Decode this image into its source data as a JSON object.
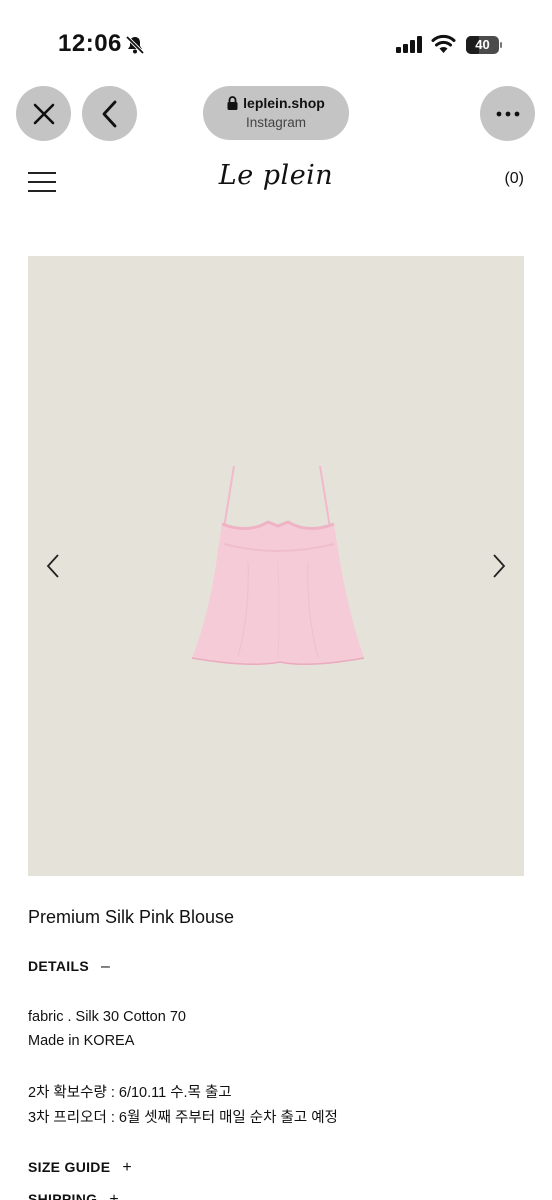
{
  "status_bar": {
    "time": "12:06",
    "battery": "40",
    "battery_level": 0.4,
    "icons": [
      "bell-slash-icon",
      "cellular-signal-icon",
      "wifi-icon",
      "battery-icon"
    ]
  },
  "browser": {
    "domain": "leplein.shop",
    "source": "Instagram",
    "icons": [
      "close-icon",
      "back-chevron-icon",
      "lock-icon",
      "more-icon"
    ]
  },
  "site": {
    "logo": "Le plein",
    "cart": "(0)",
    "icons": [
      "hamburger-menu-icon"
    ]
  },
  "gallery": {
    "background": "#e5e2d9",
    "garment_color": "#f6cbd8",
    "icons": [
      "chevron-left-icon",
      "chevron-right-icon"
    ]
  },
  "product": {
    "title": "Premium Silk Pink Blouse",
    "details_label": "DETAILS",
    "details_toggle": "–",
    "details_lines": [
      "fabric . Silk 30 Cotton 70",
      "Made in KOREA",
      "2차 확보수량 : 6/10.11 수.목 출고",
      "3차 프리오더 : 6월 셋째 주부터 매일 순차 출고 예정"
    ],
    "size_guide_label": "SIZE GUIDE",
    "size_guide_toggle": "+",
    "shipping_label": "SHIPPING",
    "shipping_toggle": "+"
  }
}
